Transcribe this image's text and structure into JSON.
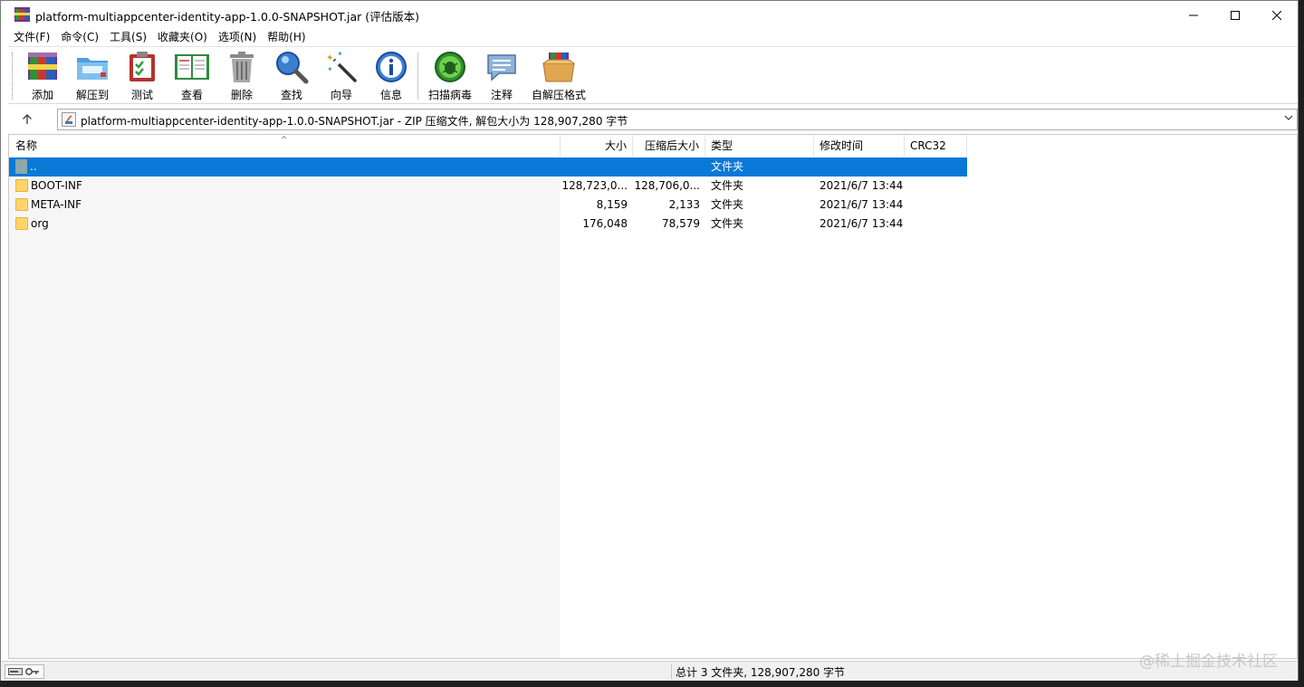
{
  "window": {
    "title": "platform-multiappcenter-identity-app-1.0.0-SNAPSHOT.jar (评估版本)"
  },
  "menu": [
    "文件(F)",
    "命令(C)",
    "工具(S)",
    "收藏夹(O)",
    "选项(N)",
    "帮助(H)"
  ],
  "toolbar": {
    "items": [
      {
        "label": "添加",
        "icon": "add-archive-icon"
      },
      {
        "label": "解压到",
        "icon": "extract-to-icon"
      },
      {
        "label": "测试",
        "icon": "test-icon"
      },
      {
        "label": "查看",
        "icon": "view-icon"
      },
      {
        "label": "删除",
        "icon": "delete-icon"
      },
      {
        "label": "查找",
        "icon": "find-icon"
      },
      {
        "label": "向导",
        "icon": "wizard-icon"
      },
      {
        "label": "信息",
        "icon": "info-icon"
      },
      {
        "label": "扫描病毒",
        "icon": "virus-scan-icon"
      },
      {
        "label": "注释",
        "icon": "comment-icon"
      },
      {
        "label": "自解压格式",
        "icon": "sfx-icon"
      }
    ]
  },
  "address": {
    "path": "platform-multiappcenter-identity-app-1.0.0-SNAPSHOT.jar - ZIP 压缩文件, 解包大小为 128,907,280 字节"
  },
  "columns": {
    "name": "名称",
    "size": "大小",
    "packed": "压缩后大小",
    "type": "类型",
    "modified": "修改时间",
    "crc": "CRC32"
  },
  "rows": [
    {
      "name": "..",
      "size": "",
      "packed": "",
      "type": "文件夹",
      "modified": "",
      "crc": "",
      "icon": "up-folder-icon",
      "selected": true
    },
    {
      "name": "BOOT-INF",
      "size": "128,723,0...",
      "packed": "128,706,0...",
      "type": "文件夹",
      "modified": "2021/6/7 13:44",
      "crc": "",
      "icon": "folder-icon"
    },
    {
      "name": "META-INF",
      "size": "8,159",
      "packed": "2,133",
      "type": "文件夹",
      "modified": "2021/6/7 13:44",
      "crc": "",
      "icon": "folder-icon"
    },
    {
      "name": "org",
      "size": "176,048",
      "packed": "78,579",
      "type": "文件夹",
      "modified": "2021/6/7 13:44",
      "crc": "",
      "icon": "folder-icon"
    }
  ],
  "status": {
    "summary": "总计 3 文件夹, 128,907,280 字节"
  },
  "watermark": "@稀土掘金技术社区",
  "colors": {
    "selection": "#0a78d7",
    "folder": "#ffd56a"
  }
}
